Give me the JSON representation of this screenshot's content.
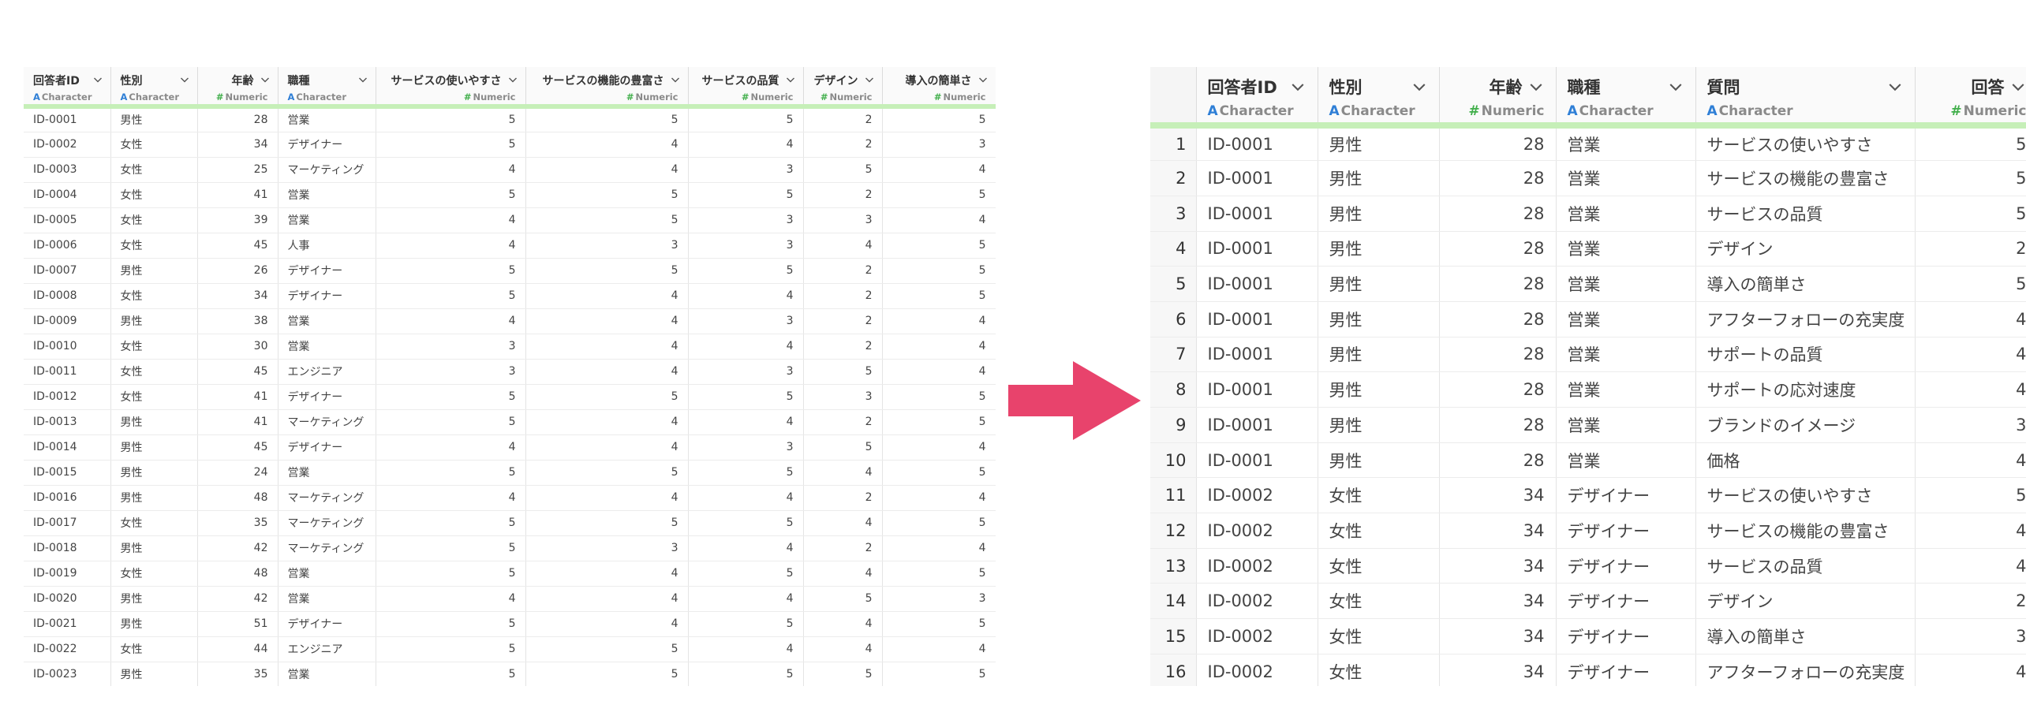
{
  "colors": {
    "header_underline": "#c6efb8",
    "arrow": "#e8436c",
    "character_icon": "#2f7fd6",
    "numeric_icon": "#3fae49"
  },
  "icons": {
    "character": "A",
    "numeric": "#",
    "dropdown": "chevron-down-icon"
  },
  "wide_table": {
    "columns": [
      {
        "name": "回答者ID",
        "type": "Character"
      },
      {
        "name": "性別",
        "type": "Character"
      },
      {
        "name": "年齢",
        "type": "Numeric"
      },
      {
        "name": "職種",
        "type": "Character"
      },
      {
        "name": "サービスの使いやすさ",
        "type": "Numeric"
      },
      {
        "name": "サービスの機能の豊富さ",
        "type": "Numeric"
      },
      {
        "name": "サービスの品質",
        "type": "Numeric"
      },
      {
        "name": "デザイン",
        "type": "Numeric"
      },
      {
        "name": "導入の簡単さ",
        "type": "Numeric"
      }
    ],
    "rows": [
      [
        "ID-0001",
        "男性",
        "28",
        "営業",
        "5",
        "5",
        "5",
        "2",
        "5"
      ],
      [
        "ID-0002",
        "女性",
        "34",
        "デザイナー",
        "5",
        "4",
        "4",
        "2",
        "3"
      ],
      [
        "ID-0003",
        "女性",
        "25",
        "マーケティング",
        "4",
        "4",
        "3",
        "5",
        "4"
      ],
      [
        "ID-0004",
        "女性",
        "41",
        "営業",
        "5",
        "5",
        "5",
        "2",
        "5"
      ],
      [
        "ID-0005",
        "女性",
        "39",
        "営業",
        "4",
        "5",
        "3",
        "3",
        "4"
      ],
      [
        "ID-0006",
        "女性",
        "45",
        "人事",
        "4",
        "3",
        "3",
        "4",
        "5"
      ],
      [
        "ID-0007",
        "男性",
        "26",
        "デザイナー",
        "5",
        "5",
        "5",
        "2",
        "5"
      ],
      [
        "ID-0008",
        "女性",
        "34",
        "デザイナー",
        "5",
        "4",
        "4",
        "2",
        "5"
      ],
      [
        "ID-0009",
        "男性",
        "38",
        "営業",
        "4",
        "4",
        "3",
        "2",
        "4"
      ],
      [
        "ID-0010",
        "女性",
        "30",
        "営業",
        "3",
        "4",
        "4",
        "2",
        "4"
      ],
      [
        "ID-0011",
        "女性",
        "45",
        "エンジニア",
        "3",
        "4",
        "3",
        "5",
        "4"
      ],
      [
        "ID-0012",
        "女性",
        "41",
        "デザイナー",
        "5",
        "5",
        "5",
        "3",
        "5"
      ],
      [
        "ID-0013",
        "男性",
        "41",
        "マーケティング",
        "5",
        "4",
        "4",
        "2",
        "5"
      ],
      [
        "ID-0014",
        "男性",
        "45",
        "デザイナー",
        "4",
        "4",
        "3",
        "5",
        "4"
      ],
      [
        "ID-0015",
        "男性",
        "24",
        "営業",
        "5",
        "5",
        "5",
        "4",
        "5"
      ],
      [
        "ID-0016",
        "男性",
        "48",
        "マーケティング",
        "4",
        "4",
        "4",
        "2",
        "4"
      ],
      [
        "ID-0017",
        "女性",
        "35",
        "マーケティング",
        "5",
        "5",
        "5",
        "4",
        "5"
      ],
      [
        "ID-0018",
        "男性",
        "42",
        "マーケティング",
        "5",
        "3",
        "4",
        "2",
        "4"
      ],
      [
        "ID-0019",
        "女性",
        "48",
        "営業",
        "5",
        "4",
        "5",
        "4",
        "5"
      ],
      [
        "ID-0020",
        "男性",
        "42",
        "営業",
        "4",
        "4",
        "4",
        "5",
        "3"
      ],
      [
        "ID-0021",
        "男性",
        "51",
        "デザイナー",
        "5",
        "4",
        "5",
        "4",
        "5"
      ],
      [
        "ID-0022",
        "女性",
        "44",
        "エンジニア",
        "5",
        "5",
        "4",
        "4",
        "4"
      ],
      [
        "ID-0023",
        "男性",
        "35",
        "営業",
        "5",
        "5",
        "5",
        "5",
        "5"
      ]
    ]
  },
  "long_table": {
    "columns": [
      {
        "name": "回答者ID",
        "type": "Character"
      },
      {
        "name": "性別",
        "type": "Character"
      },
      {
        "name": "年齢",
        "type": "Numeric"
      },
      {
        "name": "職種",
        "type": "Character"
      },
      {
        "name": "質問",
        "type": "Character"
      },
      {
        "name": "回答",
        "type": "Numeric"
      }
    ],
    "rows": [
      [
        "1",
        "ID-0001",
        "男性",
        "28",
        "営業",
        "サービスの使いやすさ",
        "5"
      ],
      [
        "2",
        "ID-0001",
        "男性",
        "28",
        "営業",
        "サービスの機能の豊富さ",
        "5"
      ],
      [
        "3",
        "ID-0001",
        "男性",
        "28",
        "営業",
        "サービスの品質",
        "5"
      ],
      [
        "4",
        "ID-0001",
        "男性",
        "28",
        "営業",
        "デザイン",
        "2"
      ],
      [
        "5",
        "ID-0001",
        "男性",
        "28",
        "営業",
        "導入の簡単さ",
        "5"
      ],
      [
        "6",
        "ID-0001",
        "男性",
        "28",
        "営業",
        "アフターフォローの充実度",
        "4"
      ],
      [
        "7",
        "ID-0001",
        "男性",
        "28",
        "営業",
        "サポートの品質",
        "4"
      ],
      [
        "8",
        "ID-0001",
        "男性",
        "28",
        "営業",
        "サポートの応対速度",
        "4"
      ],
      [
        "9",
        "ID-0001",
        "男性",
        "28",
        "営業",
        "ブランドのイメージ",
        "3"
      ],
      [
        "10",
        "ID-0001",
        "男性",
        "28",
        "営業",
        "価格",
        "4"
      ],
      [
        "11",
        "ID-0002",
        "女性",
        "34",
        "デザイナー",
        "サービスの使いやすさ",
        "5"
      ],
      [
        "12",
        "ID-0002",
        "女性",
        "34",
        "デザイナー",
        "サービスの機能の豊富さ",
        "4"
      ],
      [
        "13",
        "ID-0002",
        "女性",
        "34",
        "デザイナー",
        "サービスの品質",
        "4"
      ],
      [
        "14",
        "ID-0002",
        "女性",
        "34",
        "デザイナー",
        "デザイン",
        "2"
      ],
      [
        "15",
        "ID-0002",
        "女性",
        "34",
        "デザイナー",
        "導入の簡単さ",
        "3"
      ],
      [
        "16",
        "ID-0002",
        "女性",
        "34",
        "デザイナー",
        "アフターフォローの充実度",
        "4"
      ]
    ]
  }
}
